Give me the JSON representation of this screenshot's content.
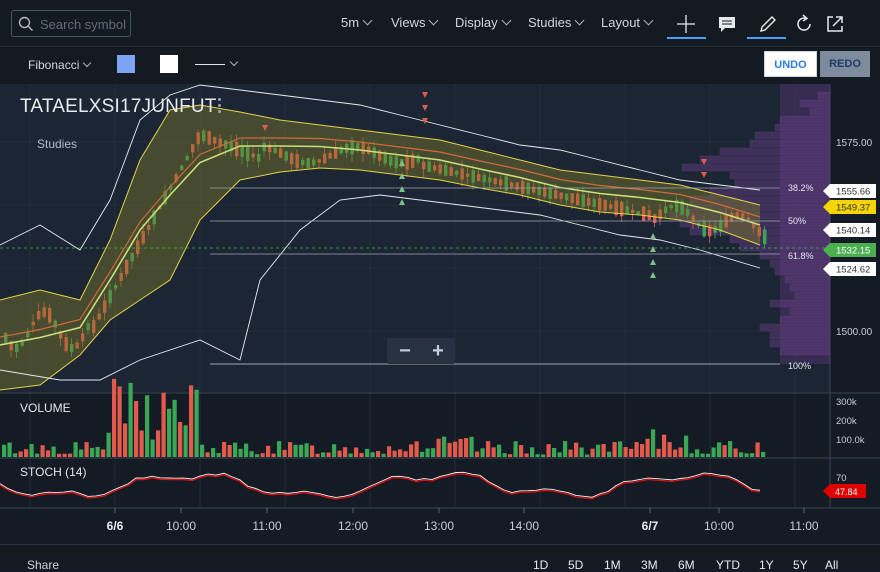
{
  "toolbar": {
    "search_placeholder": "Search symbol",
    "interval": "5m",
    "views": "Views",
    "display": "Display",
    "studies": "Studies",
    "layout": "Layout",
    "icons": [
      "crosshair-icon",
      "comment-icon",
      "pencil-icon",
      "refresh-icon",
      "popout-icon"
    ]
  },
  "drawing_bar": {
    "tool": "Fibonacci",
    "fill_color": "#7ea3f2",
    "line_color": "#ffffff",
    "undo": "UNDO",
    "redo": "REDO"
  },
  "chart": {
    "symbol": "TATAELXSI17JUNFUT",
    "studies_label": "Studies",
    "price_axis": [
      "1575.00",
      "1500.00"
    ],
    "fib_levels": [
      {
        "label": "38.2%",
        "price": 1555.66
      },
      {
        "label": "50%",
        "price": null
      },
      {
        "label": "61.8%",
        "price": null
      },
      {
        "label": "100%",
        "price": null
      }
    ],
    "price_tags": [
      {
        "text": "1555.66",
        "bg": "#ffffff",
        "fg": "#333333"
      },
      {
        "text": "1549.37",
        "bg": "#f5d400",
        "fg": "#333333"
      },
      {
        "text": "1540.14",
        "bg": "#ffffff",
        "fg": "#333333"
      },
      {
        "text": "1532.15",
        "bg": "#4caf50",
        "fg": "#ffffff"
      },
      {
        "text": "1524.62",
        "bg": "#ffffff",
        "fg": "#333333"
      }
    ],
    "volume_label": "VOLUME",
    "volume_axis": [
      "300k",
      "200k",
      "100.0k"
    ],
    "stoch_label": "STOCH (14)",
    "stoch_axis": [
      "70"
    ],
    "stoch_tag": {
      "text": "47.84",
      "bg": "#e00000"
    },
    "time_axis": [
      {
        "text": "6/6",
        "bold": true
      },
      {
        "text": "10:00",
        "bold": false
      },
      {
        "text": "11:00",
        "bold": false
      },
      {
        "text": "12:00",
        "bold": false
      },
      {
        "text": "13:00",
        "bold": false
      },
      {
        "text": "14:00",
        "bold": false
      },
      {
        "text": "6/7",
        "bold": true
      },
      {
        "text": "10:00",
        "bold": false
      },
      {
        "text": "11:00",
        "bold": false
      }
    ],
    "zoom_out": "−",
    "zoom_in": "+"
  },
  "footer": {
    "share": "Share",
    "ranges": [
      "1D",
      "5D",
      "1M",
      "3M",
      "6M",
      "YTD",
      "1Y",
      "5Y",
      "All"
    ]
  },
  "colors": {
    "background": "#141b24",
    "up": "#3aa757",
    "down": "#e25a4b",
    "accent": "#4d9ef7"
  }
}
